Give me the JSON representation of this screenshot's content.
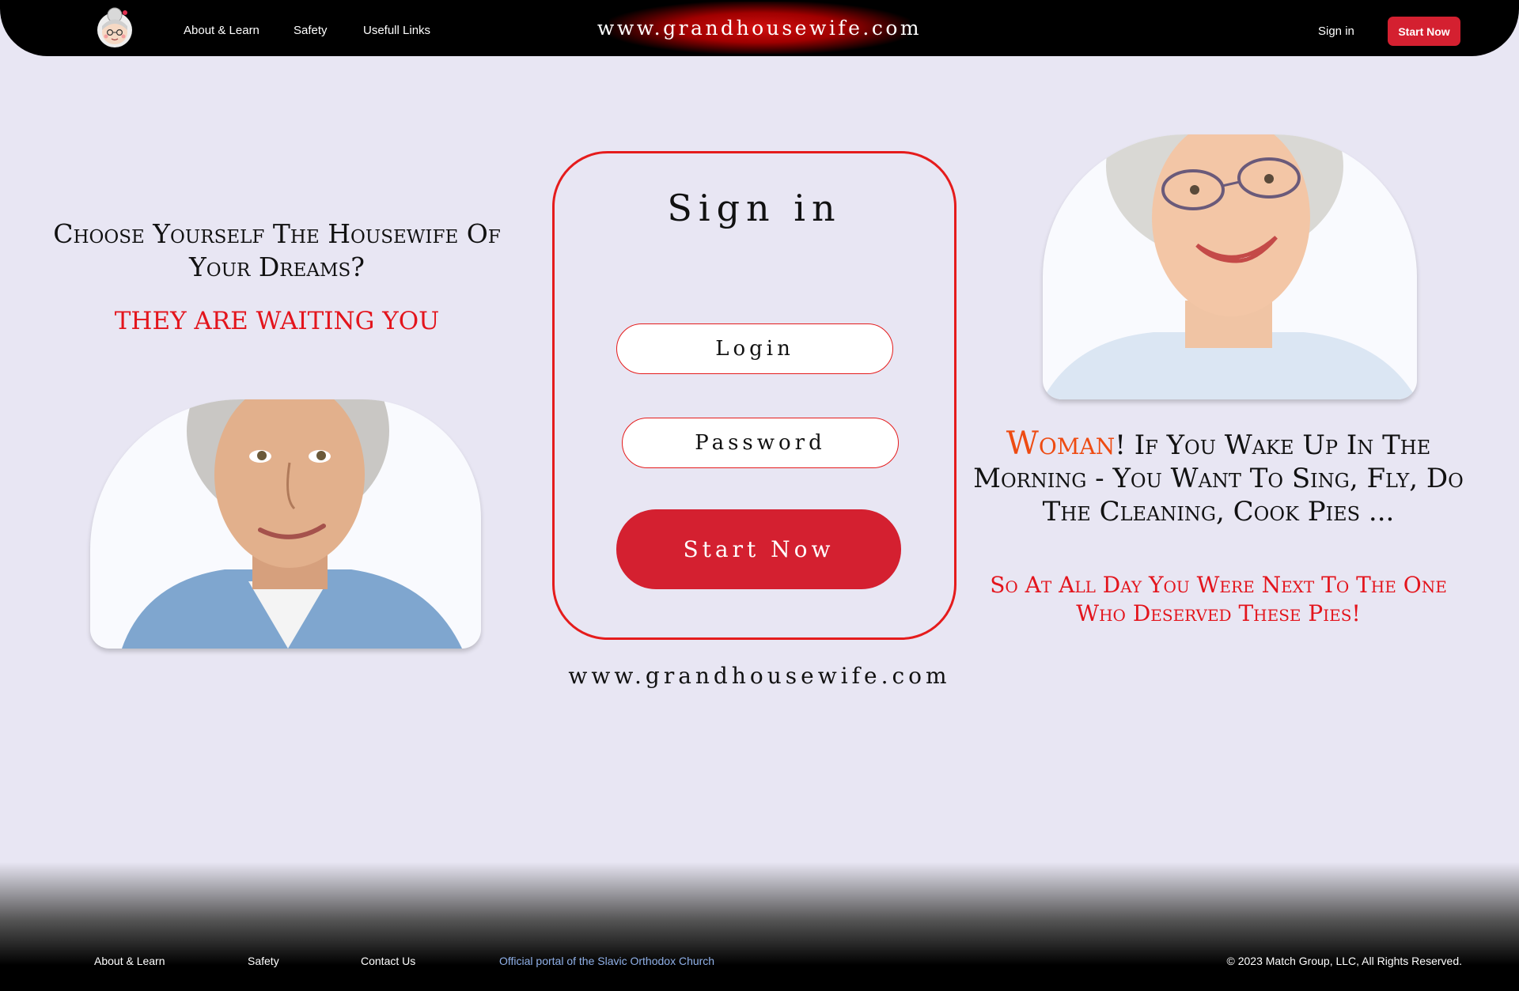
{
  "header": {
    "nav": [
      "About & Learn",
      "Safety",
      "Usefull Links"
    ],
    "brand": "www.grandhousewife.com",
    "signin": "Sign in",
    "start": "Start Now"
  },
  "left": {
    "heading": "Choose Yourself The Housewife Of Your Dreams?",
    "subheading": "THEY ARE WAITING YOU"
  },
  "signin_card": {
    "title": "Sign in",
    "login_placeholder": "Login",
    "password_placeholder": "Password",
    "submit": "Start Now"
  },
  "url_text": "www.grandhousewife.com",
  "right": {
    "accent": "Woman",
    "heading_rest": "! If You Wake Up In The Morning - You Want To Sing, Fly, Do The Cleaning, Cook Pies ...",
    "subheading": "So At All Day You Were Next To The One Who Deserved These Pies!"
  },
  "footer": {
    "links": [
      "About & Learn",
      "Safety",
      "Contact Us"
    ],
    "official": "Official portal of the Slavic Orthodox Church",
    "copyright": "© 2023 Match Group, LLC, All Rights Reserved."
  },
  "colors": {
    "accent_red": "#d42030",
    "orange": "#ee4b12",
    "background": "#e8e6f3"
  }
}
